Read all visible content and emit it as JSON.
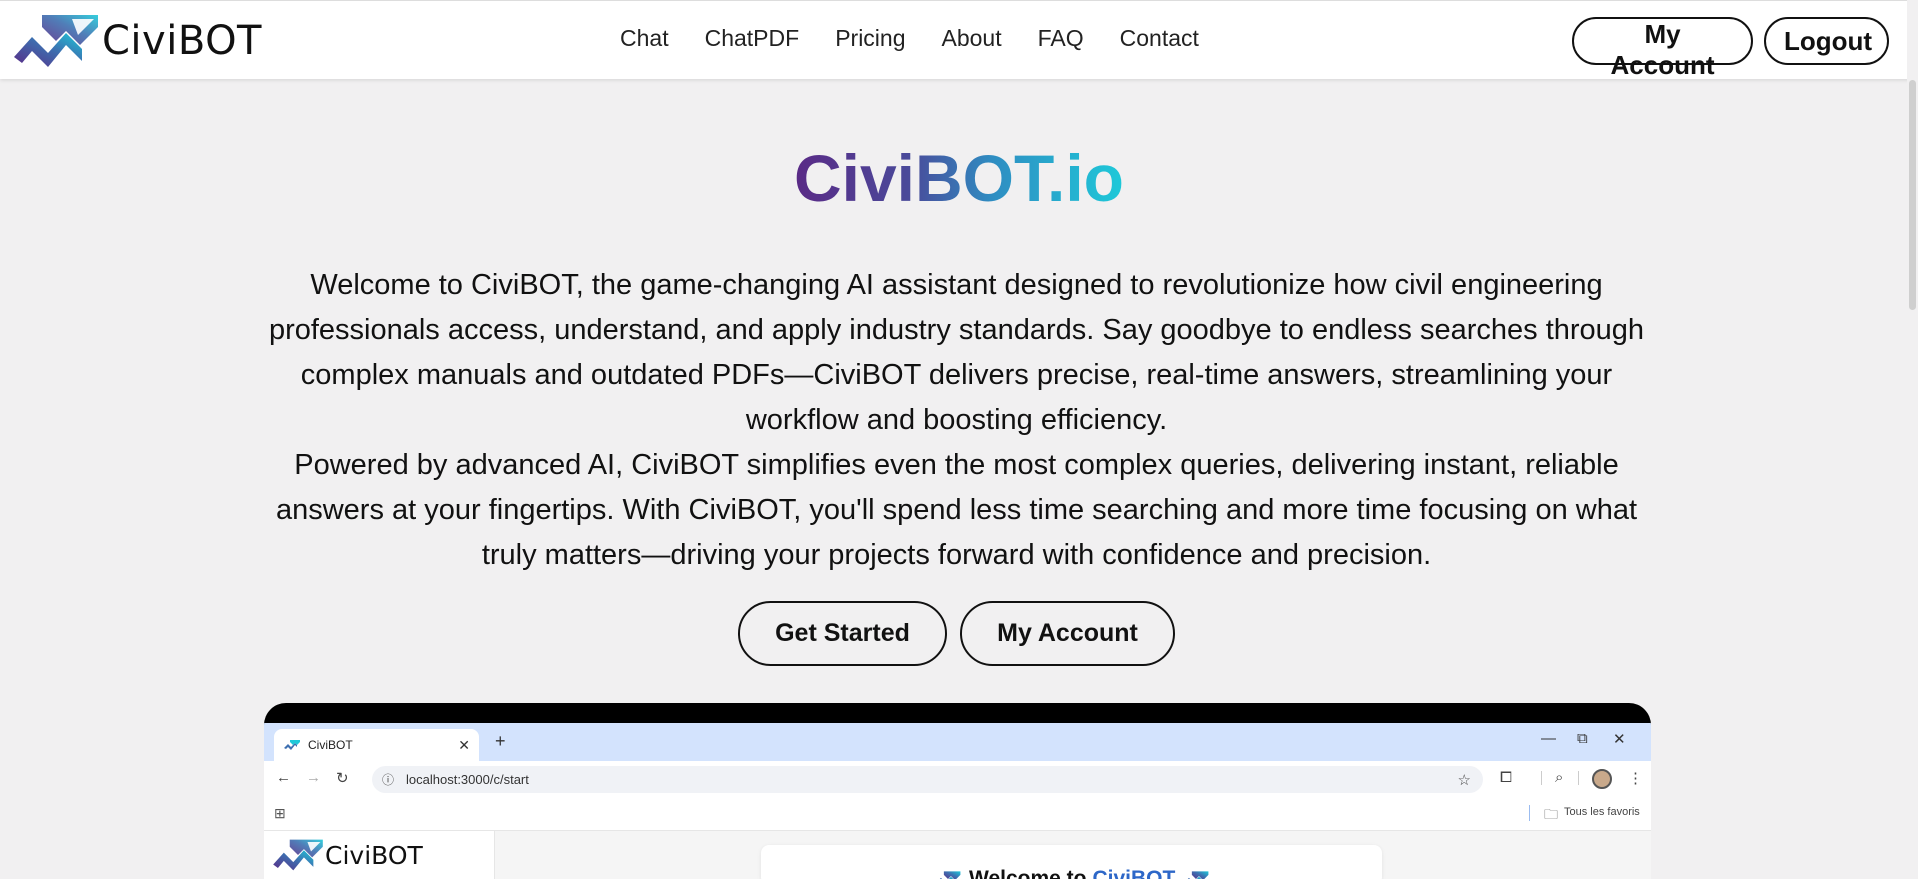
{
  "header": {
    "logo_text": "CiviBOT",
    "nav": [
      "Chat",
      "ChatPDF",
      "Pricing",
      "About",
      "FAQ",
      "Contact"
    ],
    "my_account_label": "My Account",
    "logout_label": "Logout"
  },
  "hero": {
    "title": "CiviBOT.io",
    "paragraph_1": "Welcome to CiviBOT, the game-changing AI assistant designed to revolutionize how civil engineering professionals access, understand, and apply industry standards. Say goodbye to endless searches through complex manuals and outdated PDFs—CiviBOT delivers precise, real-time answers, streamlining your workflow and boosting efficiency.",
    "paragraph_2": "Powered by advanced AI, CiviBOT simplifies even the most complex queries, delivering instant, reliable answers at your fingertips. With CiviBOT, you'll spend less time searching and more time focusing on what truly matters—driving your projects forward with confidence and precision.",
    "get_started_label": "Get Started",
    "my_account_label": "My Account"
  },
  "preview": {
    "tab_title": "CiviBOT",
    "tab_close": "✕",
    "new_tab": "+",
    "url": "localhost:3000/c/start",
    "bookmarks_label": "Tous les favoris",
    "sidebar_logo_text": "CiviBOT",
    "welcome_prefix": "Welcome to",
    "welcome_brand": "CiviBOT"
  },
  "colors": {
    "brand_purple": "#5a2a86",
    "brand_cyan": "#1ec9d9",
    "page_bg": "#f1f0f1"
  },
  "icons": [
    "logo-mark",
    "back-arrow",
    "forward-arrow",
    "reload",
    "info",
    "star",
    "extensions",
    "search-labs",
    "more-vert",
    "apps-grid",
    "folder",
    "minimize",
    "restore",
    "close"
  ]
}
